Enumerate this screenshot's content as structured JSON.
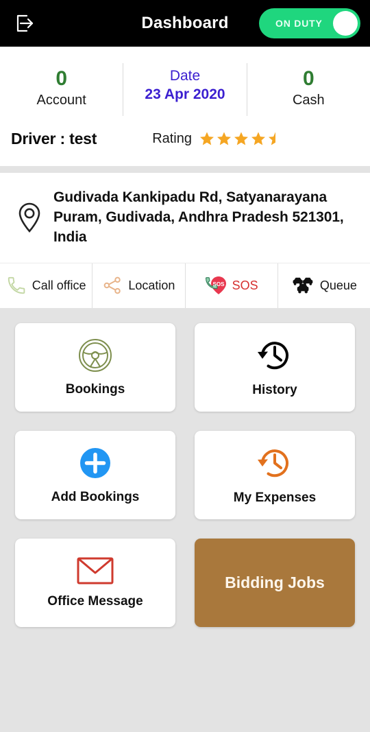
{
  "topbar": {
    "logout_icon": "logout-icon",
    "title": "Dashboard",
    "duty_toggle_label": "ON DUTY",
    "duty_toggle_state": "on",
    "bg_color": "#000000",
    "toggle_color": "#1fd67e"
  },
  "stats": [
    {
      "value": "0",
      "label": "Account",
      "value_color": "#2f7d32"
    },
    {
      "value": "Date",
      "label": "23 Apr 2020",
      "value_color": "#3b1fd0"
    },
    {
      "value": "0",
      "label": "Cash",
      "value_color": "#2f7d32"
    }
  ],
  "driver": {
    "name": "Driver : test",
    "rating_label": "Rating",
    "rating_value": 4.5,
    "star_color": "#f5a623"
  },
  "address": {
    "pin_icon": "location-pin-icon",
    "text": "Gudivada Kankipadu Rd, Satyanarayana Puram, Gudivada, Andhra Pradesh 521301, India"
  },
  "actions": [
    {
      "label": "Call office",
      "icon": "phone-icon",
      "color": "#c3d7a4"
    },
    {
      "label": "Location",
      "icon": "share-nodes-icon",
      "color": "#e8b48a"
    },
    {
      "label": "SOS",
      "icon": "sos-icon",
      "color": "#d6302f"
    },
    {
      "label": "Queue",
      "icon": "traffic-cars-icon",
      "color": "#111111"
    }
  ],
  "tiles": [
    {
      "label": "Bookings",
      "icon": "steering-wheel-icon",
      "color": "#7e8f4e",
      "style": "plain"
    },
    {
      "label": "History",
      "icon": "clock-history-icon",
      "color": "#050505",
      "style": "plain"
    },
    {
      "label": "Add Bookings",
      "icon": "plus-circle-icon",
      "color": "#2196f3",
      "style": "plain"
    },
    {
      "label": "My Expenses",
      "icon": "clock-history-icon",
      "color": "#e2711d",
      "style": "plain"
    },
    {
      "label": "Office Message",
      "icon": "envelope-icon",
      "color": "#cf3a2e",
      "style": "plain"
    },
    {
      "label": "Bidding Jobs",
      "icon": "",
      "color": "#a9783c",
      "style": "accent"
    }
  ]
}
